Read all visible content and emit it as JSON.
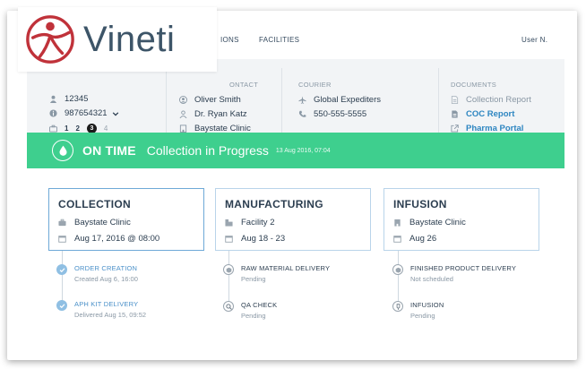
{
  "brand": {
    "name": "Vineti",
    "accent": "#c0323a",
    "text_color": "#3d5568"
  },
  "nav": {
    "items": [
      "IONS",
      "FACILITIES"
    ],
    "user": "User N."
  },
  "patient": {
    "id": "12345",
    "number": "987654321",
    "steps": [
      "1",
      "2",
      "3",
      "4"
    ],
    "current_step": "3"
  },
  "contact": {
    "heading": "ONTACT",
    "name": "Oliver Smith",
    "doctor": "Dr. Ryan Katz",
    "clinic": "Baystate Clinic"
  },
  "courier": {
    "heading": "COURIER",
    "company": "Global Expediters",
    "phone": "550-555-5555"
  },
  "documents": {
    "heading": "DOCUMENTS",
    "items": [
      "Collection Report",
      "COC Report",
      "Pharma Portal"
    ]
  },
  "status": {
    "label": "ON TIME",
    "text": "Collection in Progress",
    "date": "13 Aug 2016, 07:04",
    "color": "#3ecf8e"
  },
  "stages": [
    {
      "title": "COLLECTION",
      "site": "Baystate Clinic",
      "date": "Aug 17, 2016 @ 08:00",
      "active": true
    },
    {
      "title": "MANUFACTURING",
      "site": "Facility 2",
      "date": "Aug  18 - 23",
      "active": false
    },
    {
      "title": "INFUSION",
      "site": "Baystate Clinic",
      "date": "Aug 26",
      "active": false
    }
  ],
  "timeline": {
    "collection": [
      {
        "title": "ORDER CREATION",
        "sub": "Created Aug 6, 16:00",
        "done": true
      },
      {
        "title": "APH KIT DELIVERY",
        "sub": "Delivered Aug 15, 09:52",
        "done": true
      }
    ],
    "manufacturing": [
      {
        "title": "RAW MATERIAL DELIVERY",
        "sub": "Pending",
        "done": false
      },
      {
        "title": "QA CHECK",
        "sub": "Pending",
        "done": false
      }
    ],
    "infusion": [
      {
        "title": "FINISHED PRODUCT DELIVERY",
        "sub": "Not scheduled",
        "done": false
      },
      {
        "title": "INFUSION",
        "sub": "Pending",
        "done": false
      }
    ]
  }
}
